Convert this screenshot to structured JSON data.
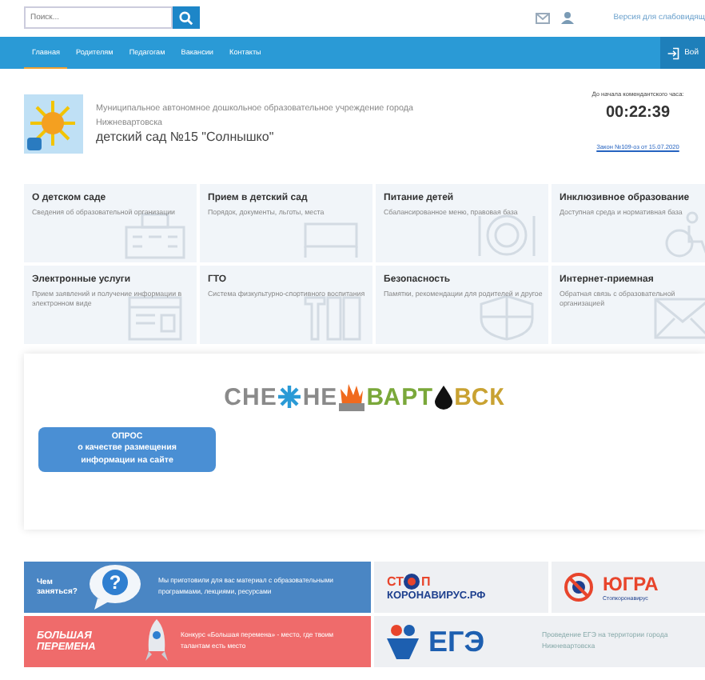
{
  "topbar": {
    "search": {
      "placeholder": "Поиск..."
    },
    "accessibility_link": "Версия для слабовидящ"
  },
  "nav": {
    "items": [
      {
        "label": "Главная",
        "selected": true
      },
      {
        "label": "Родителям",
        "selected": false
      },
      {
        "label": "Педагогам",
        "selected": false
      },
      {
        "label": "Вакансии",
        "selected": false
      },
      {
        "label": "Контакты",
        "selected": false
      }
    ],
    "login": "Вой"
  },
  "header": {
    "org_line": "Муниципальное автономное дошкольное образовательное учреждение города Нижневартовска",
    "name": "детский сад №15 \"Солнышко\"",
    "curfew_label": "До начала комендантского часа:",
    "timer": "00:22:39",
    "law_link": "Закон №109-оз от 15.07.2020"
  },
  "cards": [
    {
      "title": "О детском саде",
      "text": "Сведения об образовательной организации",
      "kind": "building"
    },
    {
      "title": "Прием в детский сад",
      "text": "Порядок, документы, льготы, места",
      "kind": "bed"
    },
    {
      "title": "Питание детей",
      "text": "Сбалансированное меню, правовая база",
      "kind": "plate"
    },
    {
      "title": "Инклюзивное образование",
      "text": "Доступная среда и нормативная база",
      "kind": "wheelchair"
    },
    {
      "title": "Электронные услуги",
      "text": "Прием заявлений и получение информации в электронном виде",
      "kind": "form"
    },
    {
      "title": "ГТО",
      "text": "Система физкультурно-спортивного воспитания",
      "kind": "gto"
    },
    {
      "title": "Безопасность",
      "text": "Памятки, рекомендации для родителей и другое",
      "kind": "shield"
    },
    {
      "title": "Интернет-приемная",
      "text": "Обратная связь с образовательной организацией",
      "kind": "mail"
    }
  ],
  "promo": {
    "logo_parts": [
      "СНЕ",
      "НЕ",
      "ВАРТ",
      "ВСК"
    ],
    "survey_lines": [
      "ОПРОС",
      "о качестве размещения",
      "информации на сайте"
    ]
  },
  "banners": [
    {
      "kind": "blue",
      "title": "Чем заняться?",
      "icon_char": "?",
      "text": "Мы приготовили для вас материал с образовательными программами, лекциями, ресурсами"
    },
    {
      "kind": "stop",
      "line1": "СТ",
      "line1b": "П",
      "line2": "КОРОНАВИРУС.РФ"
    },
    {
      "kind": "yugra",
      "title": "ЮГРА",
      "text": "Стопкоронавирус"
    },
    {
      "kind": "red",
      "title": "БОЛЬШАЯ ПЕРЕМЕНА",
      "text": "Конкурс «Большая перемена» - место, где твоим талантам есть место"
    },
    {
      "kind": "ege",
      "title": "ЕГЭ",
      "text": "Проведение ЕГЭ на территории города Нижневартовска"
    }
  ]
}
